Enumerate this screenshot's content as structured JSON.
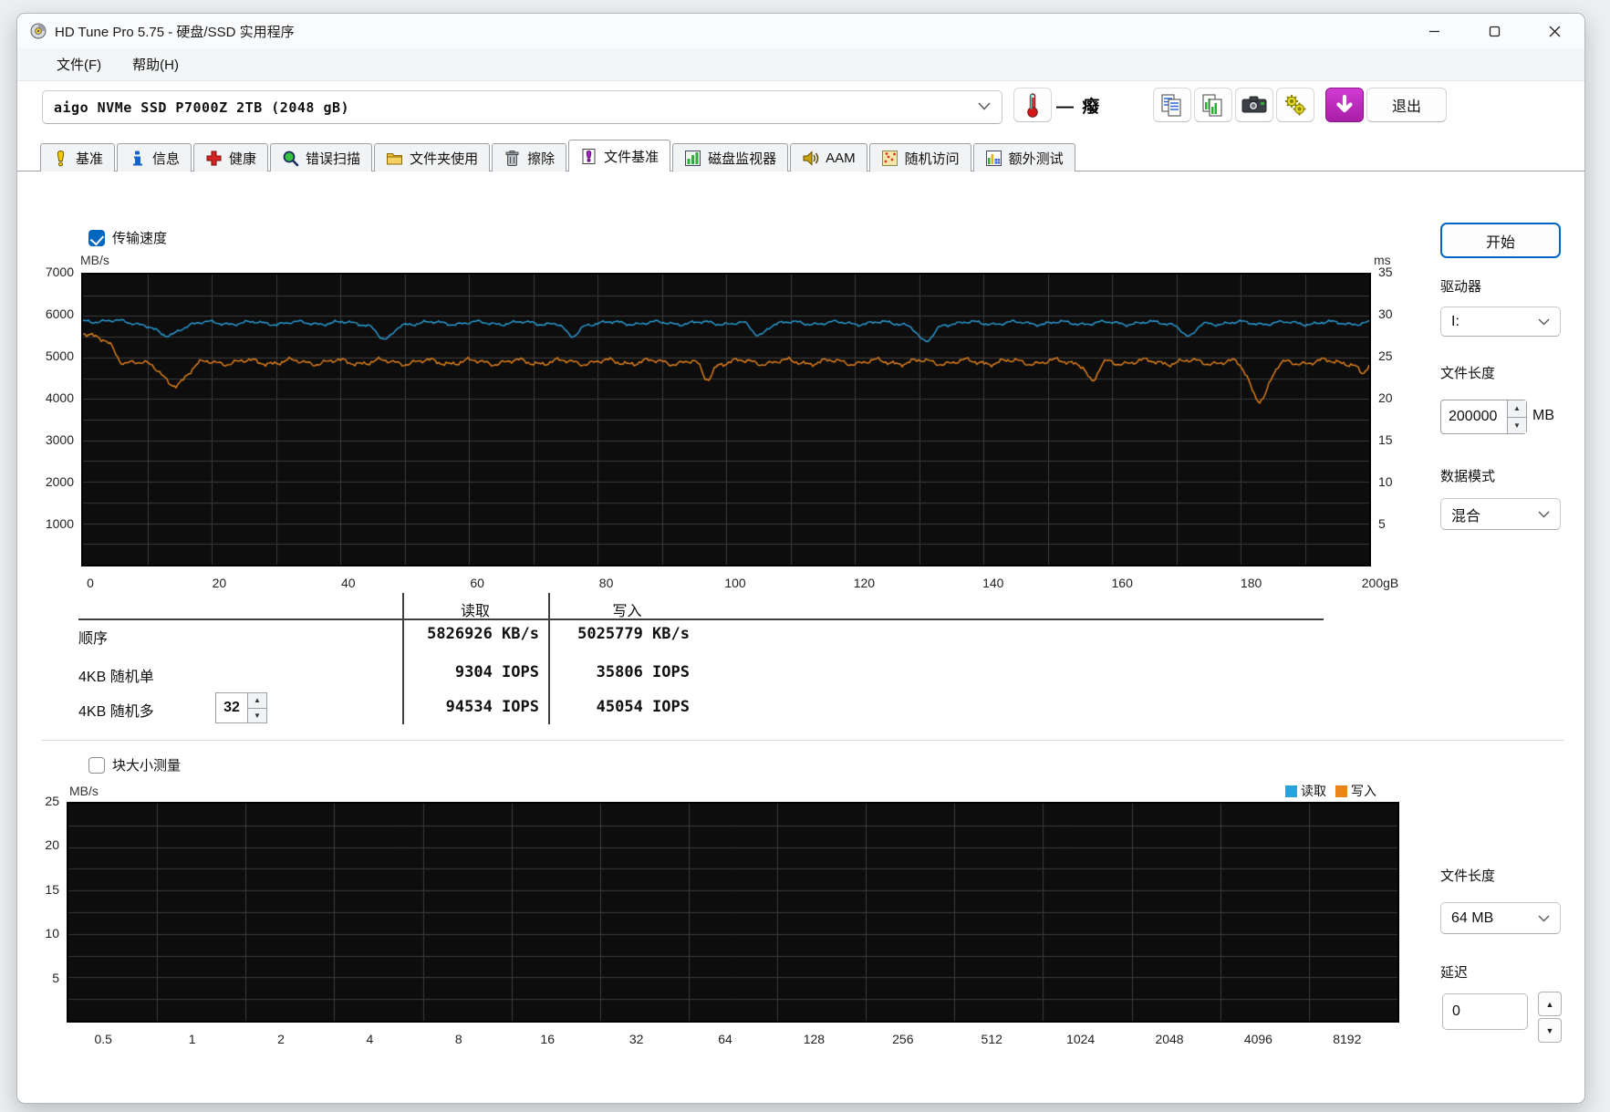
{
  "window": {
    "title": "HD Tune Pro 5.75 - 硬盘/SSD 实用程序",
    "controls": {
      "minimize": "minimize",
      "maximize": "maximize",
      "close": "close"
    }
  },
  "menu": {
    "items": [
      "文件(F)",
      "帮助(H)"
    ]
  },
  "toolbar": {
    "drive_select_value": "aigo NVMe SSD P7000Z 2TB (2048 gB)",
    "temperature_value": "— 癈",
    "buttons": [
      "copy-text",
      "copy-image",
      "screenshot",
      "options",
      "update"
    ],
    "exit_label": "退出"
  },
  "tabs": {
    "selected_index": 6,
    "items": [
      {
        "label": "基准",
        "icon": "benchmark-icon"
      },
      {
        "label": "信息",
        "icon": "info-icon"
      },
      {
        "label": "健康",
        "icon": "health-icon"
      },
      {
        "label": "错误扫描",
        "icon": "error-scan-icon"
      },
      {
        "label": "文件夹使用",
        "icon": "folder-usage-icon"
      },
      {
        "label": "擦除",
        "icon": "erase-icon"
      },
      {
        "label": "文件基准",
        "icon": "file-benchmark-icon"
      },
      {
        "label": "磁盘监视器",
        "icon": "disk-monitor-icon"
      },
      {
        "label": "AAM",
        "icon": "aam-icon"
      },
      {
        "label": "随机访问",
        "icon": "random-access-icon"
      },
      {
        "label": "额外测试",
        "icon": "extra-tests-icon"
      }
    ]
  },
  "file_benchmark": {
    "transfer_checkbox_label": "传输速度",
    "transfer_checked": true,
    "start_button_label": "开始",
    "drive_label": "驱动器",
    "drive_value": "I:",
    "file_length_label": "文件长度",
    "file_length_value": "200000",
    "file_length_unit": "MB",
    "data_mode_label": "数据模式",
    "data_mode_value": "混合"
  },
  "results_table": {
    "col_headers": [
      "读取",
      "写入"
    ],
    "rows": [
      {
        "label": "顺序",
        "read": "5826926 KB/s",
        "write": "5025779 KB/s"
      },
      {
        "label": "4KB 随机单",
        "read": "9304 IOPS",
        "write": "35806 IOPS"
      },
      {
        "label": "4KB 随机多",
        "read": "94534 IOPS",
        "write": "45054 IOPS",
        "queue_depth": "32"
      }
    ]
  },
  "block_test": {
    "checkbox_label": "块大小测量",
    "checked": false,
    "file_length_label": "文件长度",
    "file_length_value": "64 MB",
    "delay_label": "延迟",
    "delay_value": "0",
    "legend": [
      {
        "label": "读取",
        "color": "#2aa2dc"
      },
      {
        "label": "写入",
        "color": "#ea851c"
      }
    ]
  },
  "chart_data": [
    {
      "type": "line",
      "title": "传输速度",
      "xlabel_unit": "gB",
      "x_ticks": [
        "0",
        "20",
        "40",
        "60",
        "80",
        "100",
        "120",
        "140",
        "160",
        "180",
        "200gB"
      ],
      "x_range": [
        0,
        200
      ],
      "y_left": {
        "label": "MB/s",
        "min": 0,
        "max": 7000,
        "ticks": [
          7000,
          6000,
          5000,
          4000,
          3000,
          2000,
          1000
        ]
      },
      "y_right": {
        "label": "ms",
        "min": 0,
        "max": 35,
        "ticks": [
          35,
          30,
          25,
          20,
          15,
          10,
          5
        ]
      },
      "grid": {
        "x_step_units": 10,
        "y_step_units": 500,
        "color": "#3c3c3c",
        "bg": "#0d0d0d"
      },
      "series": [
        {
          "name": "读取",
          "color": "#2aa2dc",
          "approx_avg_mbs": 5830,
          "noise_amp": 80,
          "bumps": [
            {
              "x": 2,
              "raise": 60,
              "w": 3
            }
          ],
          "dips": [
            {
              "x": 13,
              "drop": 330,
              "w": 1.6
            },
            {
              "x": 47,
              "drop": 430,
              "w": 1.2
            },
            {
              "x": 76,
              "drop": 350,
              "w": 1.0
            },
            {
              "x": 105,
              "drop": 300,
              "w": 1.0
            },
            {
              "x": 131,
              "drop": 480,
              "w": 1.2
            },
            {
              "x": 172,
              "drop": 350,
              "w": 1.0
            }
          ]
        },
        {
          "name": "写入",
          "color": "#ea851c",
          "approx_avg_mbs": 4890,
          "noise_amp": 120,
          "bumps": [
            {
              "x": 0,
              "raise": 730,
              "w": 4
            }
          ],
          "dips": [
            {
              "x": 6,
              "drop": 260,
              "w": 1.0
            },
            {
              "x": 14,
              "drop": 530,
              "w": 2.0
            },
            {
              "x": 97,
              "drop": 420,
              "w": 0.8
            },
            {
              "x": 157,
              "drop": 500,
              "w": 0.8
            },
            {
              "x": 183,
              "drop": 880,
              "w": 1.5
            },
            {
              "x": 199,
              "drop": 300,
              "w": 0.7
            }
          ]
        }
      ]
    },
    {
      "type": "line",
      "title": "块大小测量",
      "empty": true,
      "categories": [
        "0.5",
        "1",
        "2",
        "4",
        "8",
        "16",
        "32",
        "64",
        "128",
        "256",
        "512",
        "1024",
        "2048",
        "4096",
        "8192"
      ],
      "y": {
        "label": "MB/s",
        "min": 0,
        "max": 25,
        "ticks": [
          25,
          20,
          15,
          10,
          5
        ]
      },
      "grid": {
        "color": "#3c3c3c",
        "bg": "#0d0d0d"
      },
      "legend": [
        "读取",
        "写入"
      ]
    }
  ]
}
